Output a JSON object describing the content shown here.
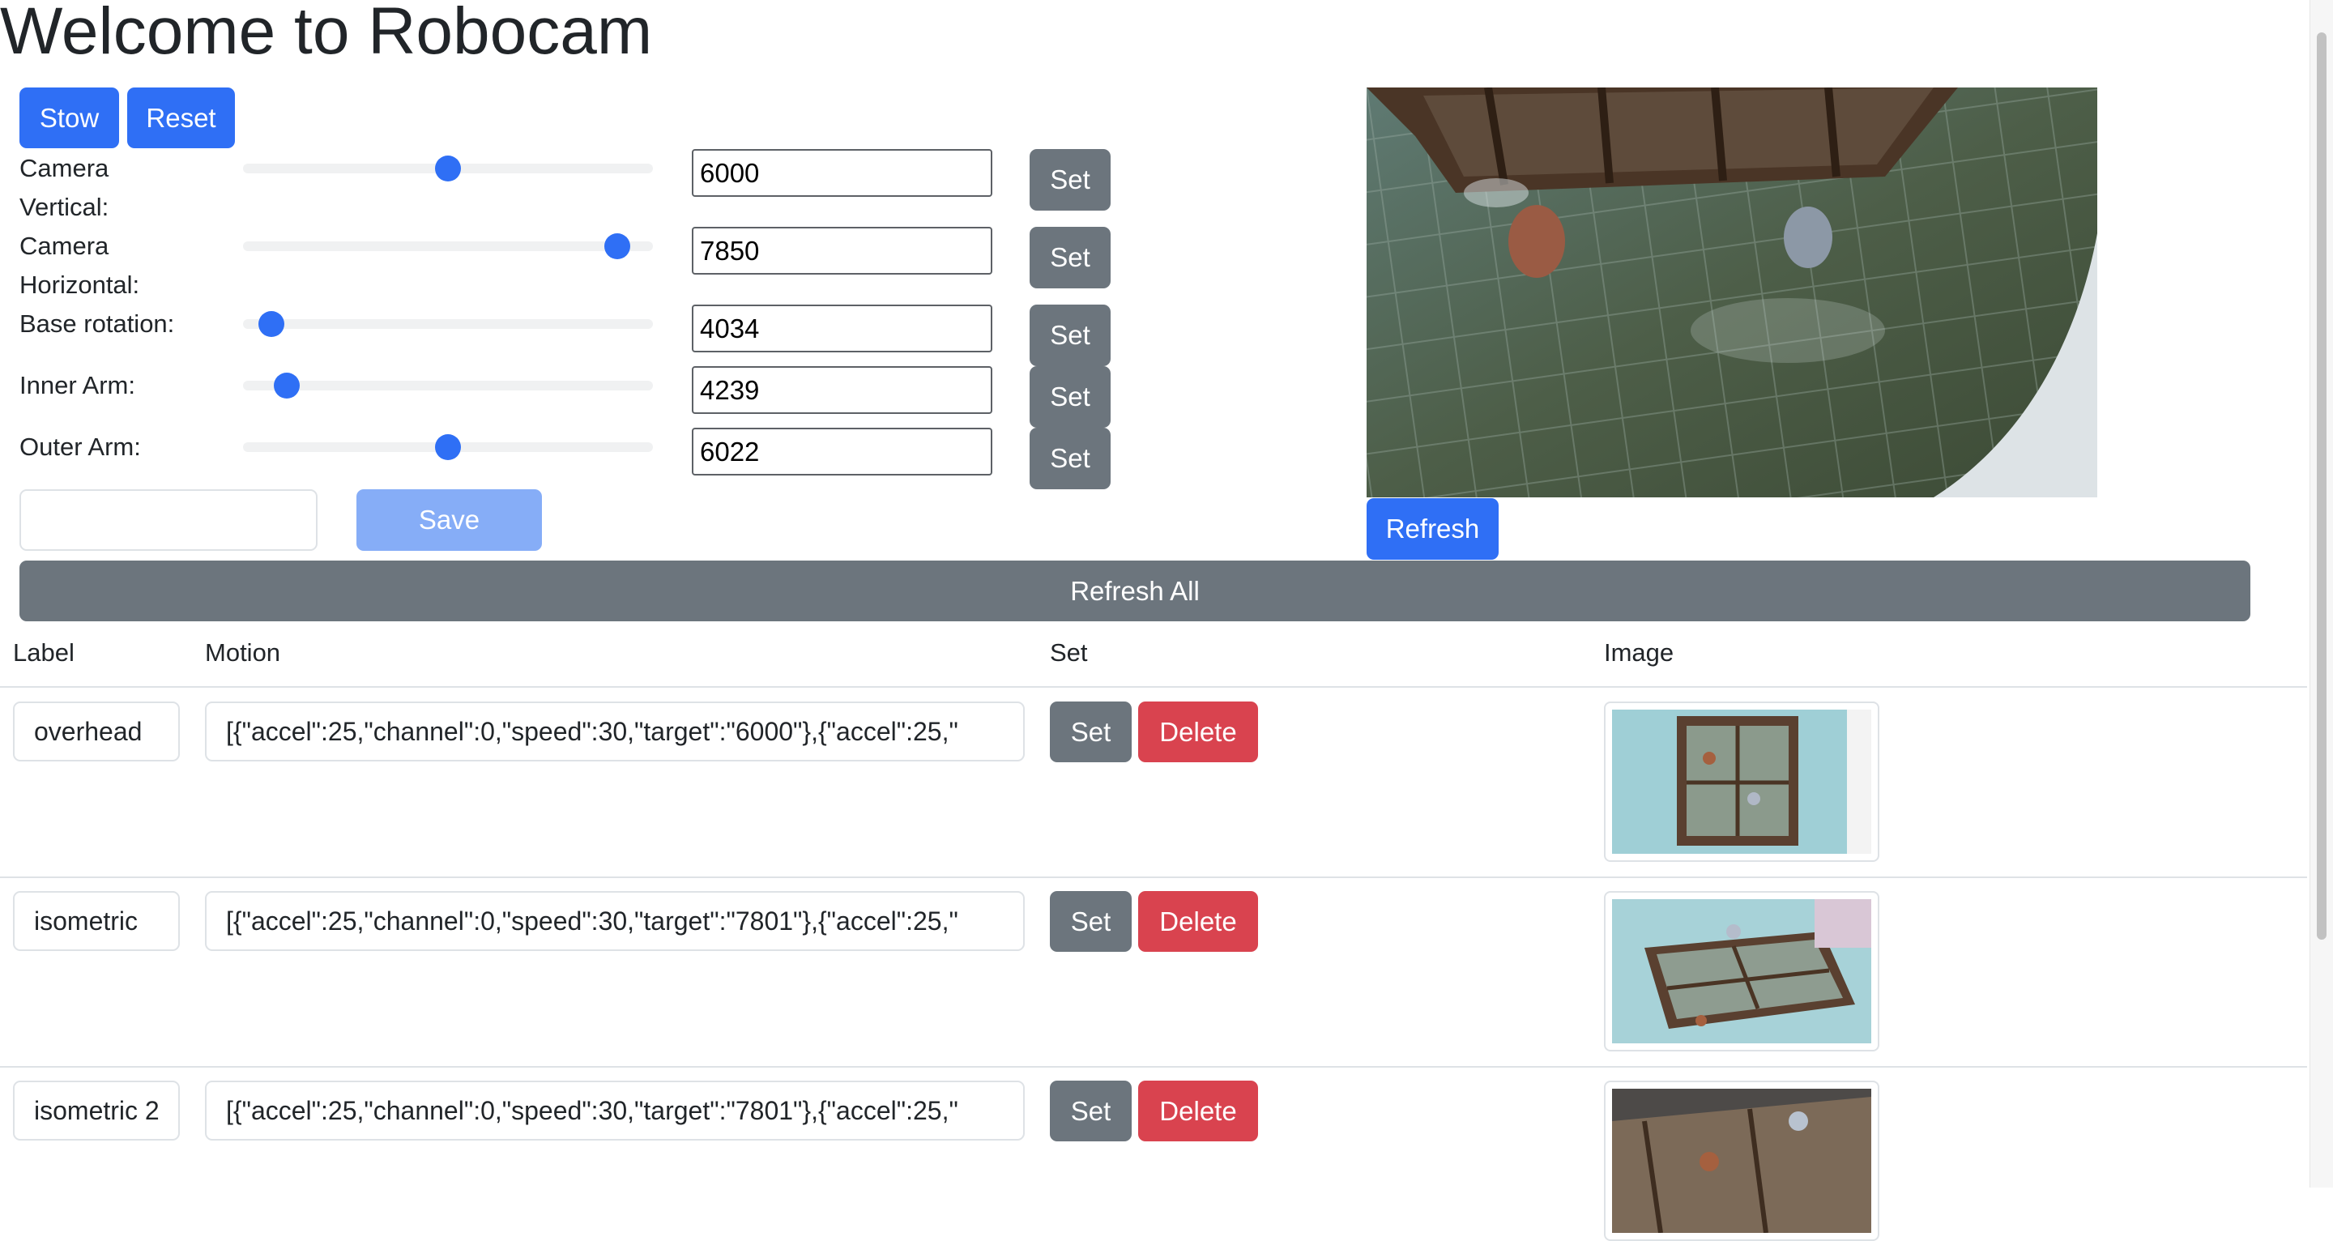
{
  "page": {
    "title": "Welcome to Robocam"
  },
  "top_buttons": {
    "stow": "Stow",
    "reset": "Reset"
  },
  "controls": [
    {
      "label_line1": "Camera",
      "label_line2": "Vertical:",
      "value": "6000",
      "slider_fraction": 0.5,
      "set_label": "Set"
    },
    {
      "label_line1": "Camera",
      "label_line2": "Horizontal:",
      "value": "7850",
      "slider_fraction": 0.94,
      "set_label": "Set"
    },
    {
      "label_line1": "Base rotation:",
      "label_line2": "",
      "value": "4034",
      "slider_fraction": 0.04,
      "set_label": "Set"
    },
    {
      "label_line1": "Inner Arm:",
      "label_line2": "",
      "value": "4239",
      "slider_fraction": 0.08,
      "set_label": "Set"
    },
    {
      "label_line1": "Outer Arm:",
      "label_line2": "",
      "value": "6022",
      "slider_fraction": 0.5,
      "set_label": "Set"
    }
  ],
  "save": {
    "input_value": "",
    "button_label": "Save"
  },
  "camera": {
    "refresh_label": "Refresh"
  },
  "refresh_all_label": "Refresh All",
  "table": {
    "headers": {
      "label": "Label",
      "motion": "Motion",
      "set": "Set",
      "image": "Image"
    },
    "rows": [
      {
        "label": "overhead",
        "motion": "[{\"accel\":25,\"channel\":0,\"speed\":30,\"target\":\"6000\"},{\"accel\":25,\"",
        "set_label": "Set",
        "delete_label": "Delete"
      },
      {
        "label": "isometric",
        "motion": "[{\"accel\":25,\"channel\":0,\"speed\":30,\"target\":\"7801\"},{\"accel\":25,\"",
        "set_label": "Set",
        "delete_label": "Delete"
      },
      {
        "label": "isometric 2",
        "motion": "[{\"accel\":25,\"channel\":0,\"speed\":30,\"target\":\"7801\"},{\"accel\":25,\"",
        "set_label": "Set",
        "delete_label": "Delete"
      }
    ]
  },
  "colors": {
    "primary": "#2f6ff5",
    "secondary": "#6c757d",
    "danger": "#d9434f",
    "primary_disabled": "#86adf7"
  }
}
